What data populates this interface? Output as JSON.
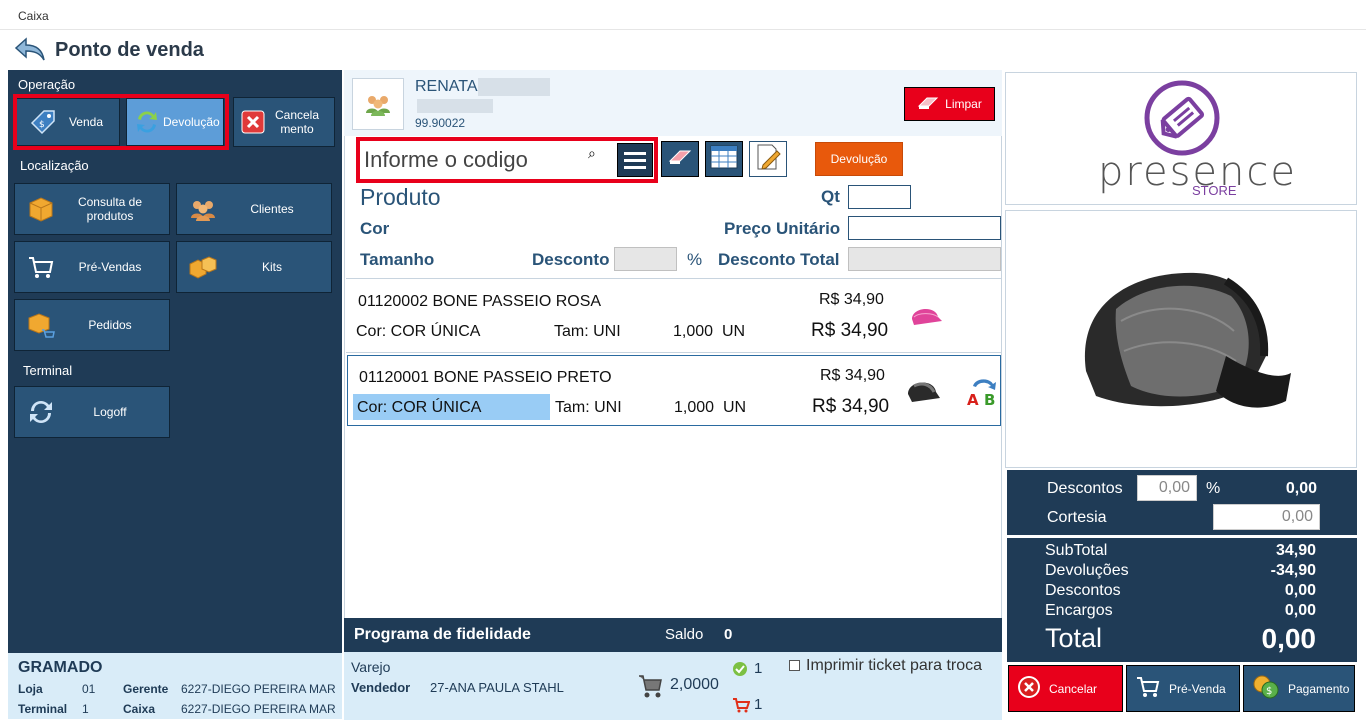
{
  "window": {
    "title": "Caixa"
  },
  "header": {
    "title": "Ponto de venda"
  },
  "sidebar": {
    "operacao_label": "Operação",
    "venda": "Venda",
    "devolucao": "Devolução",
    "cancelamento": "Cancela\nmento",
    "localizacao_label": "Localização",
    "consulta": "Consulta de produtos",
    "clientes": "Clientes",
    "prevendas": "Pré-Vendas",
    "kits": "Kits",
    "pedidos": "Pedidos",
    "terminal_label": "Terminal",
    "logoff": "Logoff"
  },
  "store_info": {
    "city": "GRAMADO",
    "loja_label": "Loja",
    "loja": "01",
    "gerente_label": "Gerente",
    "gerente": "6227-DIEGO PEREIRA MAR",
    "terminal_label": "Terminal",
    "terminal": "1",
    "caixa_label": "Caixa",
    "caixa": "6227-DIEGO PEREIRA MAR"
  },
  "customer": {
    "name": "RENATA",
    "code": "99.90022",
    "limpar": "Limpar"
  },
  "search": {
    "placeholder": "Informe o codigo"
  },
  "devolucao_button": "Devolução",
  "form": {
    "produto": "Produto",
    "qt": "Qt",
    "cor": "Cor",
    "preco_unitario": "Preço Unitário",
    "tamanho": "Tamanho",
    "desconto": "Desconto",
    "pct": "%",
    "desconto_total": "Desconto Total"
  },
  "items": [
    {
      "code_name": "01120002  BONE PASSEIO ROSA",
      "price": "R$ 34,90",
      "cor": "Cor: COR ÚNICA",
      "tam": "Tam: UNI",
      "qty": "1,000",
      "unit": "UN",
      "total": "R$ 34,90",
      "thumb_color": "#e0449a"
    },
    {
      "code_name": "01120001  BONE PASSEIO PRETO",
      "price": "R$ 34,90",
      "cor": "Cor: COR ÚNICA",
      "tam": "Tam: UNI",
      "qty": "1,000",
      "unit": "UN",
      "total": "R$ 34,90",
      "thumb_color": "#2a2a2a"
    }
  ],
  "fidelidade": {
    "label": "Programa de fidelidade",
    "saldo_label": "Saldo",
    "saldo": "0"
  },
  "footer_center": {
    "varejo": "Varejo",
    "vendedor_label": "Vendedor",
    "vendedor": "27-ANA PAULA STAHL",
    "cart_total": "2,0000",
    "ok_count": "1",
    "cart_count": "1",
    "imprimir": "Imprimir ticket para troca"
  },
  "logo": {
    "brand": "presence",
    "sub": "STORE",
    "color": "#7b3fa0"
  },
  "totals": {
    "descontos_label": "Descontos",
    "descontos_input": "0,00",
    "pct": "%",
    "descontos_value": "0,00",
    "cortesia_label": "Cortesia",
    "cortesia_input": "0,00",
    "subtotal_label": "SubTotal",
    "subtotal": "34,90",
    "devolucoes_label": "Devoluções",
    "devolucoes": "-34,90",
    "descontos2_label": "Descontos",
    "descontos2": "0,00",
    "encargos_label": "Encargos",
    "encargos": "0,00",
    "total_label": "Total",
    "total": "0,00"
  },
  "actions": {
    "cancelar": "Cancelar",
    "prevenda": "Pré-Venda",
    "pagamento": "Pagamento"
  },
  "colors": {
    "navy": "#1f3b56",
    "tile": "#2a5478",
    "red": "#e8001b",
    "orange": "#e8590c",
    "light_blue": "#d9ecf8"
  }
}
